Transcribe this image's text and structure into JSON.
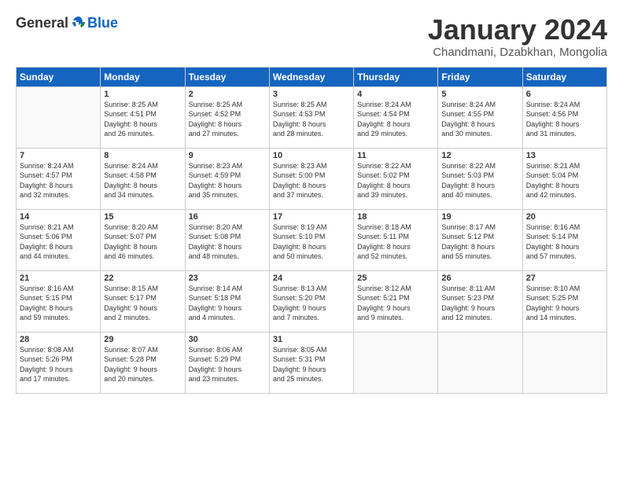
{
  "logo": {
    "general": "General",
    "blue": "Blue"
  },
  "header": {
    "title": "January 2024",
    "subtitle": "Chandmani, Dzabkhan, Mongolia"
  },
  "days_of_week": [
    "Sunday",
    "Monday",
    "Tuesday",
    "Wednesday",
    "Thursday",
    "Friday",
    "Saturday"
  ],
  "weeks": [
    [
      {
        "day": "",
        "info": ""
      },
      {
        "day": "1",
        "info": "Sunrise: 8:25 AM\nSunset: 4:51 PM\nDaylight: 8 hours\nand 26 minutes."
      },
      {
        "day": "2",
        "info": "Sunrise: 8:25 AM\nSunset: 4:52 PM\nDaylight: 8 hours\nand 27 minutes."
      },
      {
        "day": "3",
        "info": "Sunrise: 8:25 AM\nSunset: 4:53 PM\nDaylight: 8 hours\nand 28 minutes."
      },
      {
        "day": "4",
        "info": "Sunrise: 8:24 AM\nSunset: 4:54 PM\nDaylight: 8 hours\nand 29 minutes."
      },
      {
        "day": "5",
        "info": "Sunrise: 8:24 AM\nSunset: 4:55 PM\nDaylight: 8 hours\nand 30 minutes."
      },
      {
        "day": "6",
        "info": "Sunrise: 8:24 AM\nSunset: 4:56 PM\nDaylight: 8 hours\nand 31 minutes."
      }
    ],
    [
      {
        "day": "7",
        "info": "Sunrise: 8:24 AM\nSunset: 4:57 PM\nDaylight: 8 hours\nand 32 minutes."
      },
      {
        "day": "8",
        "info": "Sunrise: 8:24 AM\nSunset: 4:58 PM\nDaylight: 8 hours\nand 34 minutes."
      },
      {
        "day": "9",
        "info": "Sunrise: 8:23 AM\nSunset: 4:59 PM\nDaylight: 8 hours\nand 35 minutes."
      },
      {
        "day": "10",
        "info": "Sunrise: 8:23 AM\nSunset: 5:00 PM\nDaylight: 8 hours\nand 37 minutes."
      },
      {
        "day": "11",
        "info": "Sunrise: 8:22 AM\nSunset: 5:02 PM\nDaylight: 8 hours\nand 39 minutes."
      },
      {
        "day": "12",
        "info": "Sunrise: 8:22 AM\nSunset: 5:03 PM\nDaylight: 8 hours\nand 40 minutes."
      },
      {
        "day": "13",
        "info": "Sunrise: 8:21 AM\nSunset: 5:04 PM\nDaylight: 8 hours\nand 42 minutes."
      }
    ],
    [
      {
        "day": "14",
        "info": "Sunrise: 8:21 AM\nSunset: 5:06 PM\nDaylight: 8 hours\nand 44 minutes."
      },
      {
        "day": "15",
        "info": "Sunrise: 8:20 AM\nSunset: 5:07 PM\nDaylight: 8 hours\nand 46 minutes."
      },
      {
        "day": "16",
        "info": "Sunrise: 8:20 AM\nSunset: 5:08 PM\nDaylight: 8 hours\nand 48 minutes."
      },
      {
        "day": "17",
        "info": "Sunrise: 8:19 AM\nSunset: 5:10 PM\nDaylight: 8 hours\nand 50 minutes."
      },
      {
        "day": "18",
        "info": "Sunrise: 8:18 AM\nSunset: 5:11 PM\nDaylight: 8 hours\nand 52 minutes."
      },
      {
        "day": "19",
        "info": "Sunrise: 8:17 AM\nSunset: 5:12 PM\nDaylight: 8 hours\nand 55 minutes."
      },
      {
        "day": "20",
        "info": "Sunrise: 8:16 AM\nSunset: 5:14 PM\nDaylight: 8 hours\nand 57 minutes."
      }
    ],
    [
      {
        "day": "21",
        "info": "Sunrise: 8:16 AM\nSunset: 5:15 PM\nDaylight: 8 hours\nand 59 minutes."
      },
      {
        "day": "22",
        "info": "Sunrise: 8:15 AM\nSunset: 5:17 PM\nDaylight: 9 hours\nand 2 minutes."
      },
      {
        "day": "23",
        "info": "Sunrise: 8:14 AM\nSunset: 5:18 PM\nDaylight: 9 hours\nand 4 minutes."
      },
      {
        "day": "24",
        "info": "Sunrise: 8:13 AM\nSunset: 5:20 PM\nDaylight: 9 hours\nand 7 minutes."
      },
      {
        "day": "25",
        "info": "Sunrise: 8:12 AM\nSunset: 5:21 PM\nDaylight: 9 hours\nand 9 minutes."
      },
      {
        "day": "26",
        "info": "Sunrise: 8:11 AM\nSunset: 5:23 PM\nDaylight: 9 hours\nand 12 minutes."
      },
      {
        "day": "27",
        "info": "Sunrise: 8:10 AM\nSunset: 5:25 PM\nDaylight: 9 hours\nand 14 minutes."
      }
    ],
    [
      {
        "day": "28",
        "info": "Sunrise: 8:08 AM\nSunset: 5:26 PM\nDaylight: 9 hours\nand 17 minutes."
      },
      {
        "day": "29",
        "info": "Sunrise: 8:07 AM\nSunset: 5:28 PM\nDaylight: 9 hours\nand 20 minutes."
      },
      {
        "day": "30",
        "info": "Sunrise: 8:06 AM\nSunset: 5:29 PM\nDaylight: 9 hours\nand 23 minutes."
      },
      {
        "day": "31",
        "info": "Sunrise: 8:05 AM\nSunset: 5:31 PM\nDaylight: 9 hours\nand 25 minutes."
      },
      {
        "day": "",
        "info": ""
      },
      {
        "day": "",
        "info": ""
      },
      {
        "day": "",
        "info": ""
      }
    ]
  ]
}
